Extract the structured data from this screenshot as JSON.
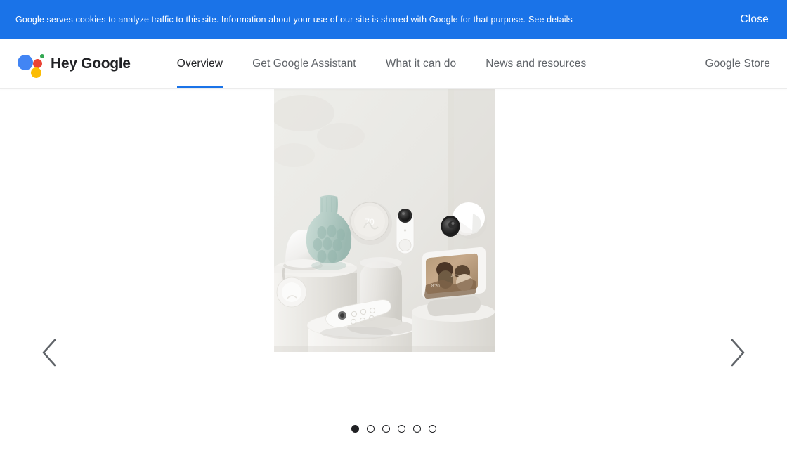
{
  "cookie_banner": {
    "message": "Google serves cookies to analyze traffic to this site. Information about your use of our site is shared with Google for that purpose.",
    "details_link": "See details",
    "close_label": "Close",
    "background_color": "#1a73e8"
  },
  "header": {
    "brand_name": "Hey Google",
    "logo_icon": "google-assistant-logo",
    "logo_colors": {
      "blue": "#4285f4",
      "red": "#ea4335",
      "yellow": "#fbbc05",
      "green": "#34a853"
    },
    "nav": [
      {
        "label": "Overview",
        "active": true
      },
      {
        "label": "Get Google Assistant",
        "active": false
      },
      {
        "label": "What it can do",
        "active": false
      },
      {
        "label": "News and resources",
        "active": false
      }
    ],
    "store_link": "Google Store",
    "active_indicator_color": "#1a73e8"
  },
  "carousel": {
    "prev_icon": "chevron-left-icon",
    "next_icon": "chevron-right-icon",
    "slide_alt": "Google Nest smart home product family on white pedestals",
    "total_slides": 6,
    "active_slide": 1,
    "dots": [
      {
        "index": 1,
        "active": true
      },
      {
        "index": 2,
        "active": false
      },
      {
        "index": 3,
        "active": false
      },
      {
        "index": 4,
        "active": false
      },
      {
        "index": 5,
        "active": false
      },
      {
        "index": 6,
        "active": false
      }
    ]
  }
}
